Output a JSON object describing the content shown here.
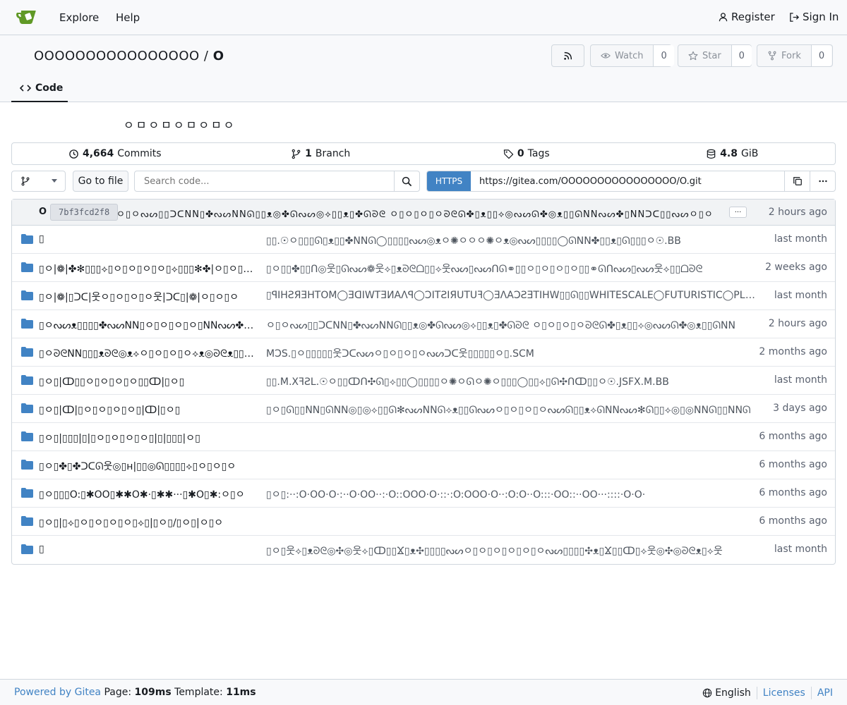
{
  "nav": {
    "explore": "Explore",
    "help": "Help",
    "register": "Register",
    "signin": "Sign In"
  },
  "repo": {
    "owner": "OOOOOOOOOOOOOOOO",
    "separator": "/",
    "name": "O",
    "description": "ㅇㅁㅇㅁㅇㅁㅇㅁㅇ",
    "watch_label": "Watch",
    "watch_count": "0",
    "star_label": "Star",
    "star_count": "0",
    "fork_label": "Fork",
    "fork_count": "0",
    "tab_code": "Code"
  },
  "stats": {
    "commits_num": "4,664",
    "commits_label": "Commits",
    "branches_num": "1",
    "branches_label": "Branch",
    "tags_num": "0",
    "tags_label": "Tags",
    "size_num": "4.8",
    "size_unit": "GiB"
  },
  "toolbar": {
    "goto_file": "Go to file",
    "search_placeholder": "Search code...",
    "clone_protocol": "HTTPS",
    "clone_url": "https://gitea.com/OOOOOOOOOOOOOOOO/O.git"
  },
  "latest_commit": {
    "author": "O",
    "sha": "7bf3fcd2f8",
    "message": "ㅇ▯ㅇᔓᔕ▯▯ᑐᑕNN▯✤ᔓᔕNNᘏ▯▯ᴥ◎✤ᘏᔓᔕ◎⟡▯▯ᴥ▯✤ᘏᘐᘓ ㅇ▯ㅇ▯ㅇ▯ㅇᘐᘓᘏ✤▯ᴥ▯▯⟡◎ᔓᔕᘏ✤◎ᴥ▯▯ᘏNNᔓᔕ✤▯NNᑐᑕ▯▯ᔓᔕㅇ▯ㅇ",
    "more": "···",
    "time": "2 hours ago"
  },
  "files": [
    {
      "name": "▯",
      "message": "▯▯.☉ㅇ▯▯▯ᘏ▯ᴥ▯▯✤NNᘏ◯▯▯▯▯ᔓᔕ◎ᴥㅇ✺ㅇㅇㅇ✺ㅇᴥ◎ᔓᔕ▯▯▯▯◯ᘏNN✤▯▯ᴥ▯ᘏ▯▯▯ㅇ☉.BB",
      "time": "last month"
    },
    {
      "name": "▯ㅇ|❁|✤✻▯▯▯⟡▯ㅇ▯ㅇ▯ㅇ▯ㅇ▯⟡▯▯▯✻✤|ㅇ▯ㅇ▯ㅇ▯ㅇ",
      "message": "▯ㅇ▯▯✤▯▯ᑎ◎웃▯ᘏᔓᔕ❁웃⟡▯ᴥᘐᘓᗝ▯▯⟡웃ᔓᔕ▯ᔓᔕᑎᘏ⚭▯▯ㅇ▯ㅇ▯ㅇ▯ㅇ▯▯⚭ᘏᑎᔓᔕ▯ᔓᔕ웃⟡▯▯ᗝᘐᘓ",
      "time": "2 weeks ago"
    },
    {
      "name": "▯ㅇ|❁|▯ᑐᑕ|웃ㅇ▯ㅇ▯ㅇ▯ㅇ웃|ᑐᑕ▯|❁|ㅇ▯ㅇ▯ㅇ",
      "message": "▯ꟼIHꙄЯƎHTOM◯ƎᗡIWTƎИAɅꟼ◯ƆITꙄIЯUTUꟻ◯ƎɅAƆꙄƎTIHW▯▯ᘏ▯▯WHITESCALE◯FUTURISTIC◯PLANETWIDE◯MOTHERSHIP",
      "time": "last month"
    },
    {
      "name": "▯ㅇᔓᔕᴥ▯▯▯▯✤ᔓᔕNN▯ㅇ▯ㅇ▯ㅇ▯ㅇ▯NNᔓᔕ✤▯▯▯▯ᴥᔓᔕㅇ▯",
      "message": "ㅇ▯ㅇᔓᔕ▯▯ᑐᑕNN▯✤ᔓᔕNNᘏ▯▯ᴥ◎✤ᘏᔓᔕ◎⟡▯▯ᴥ▯✤ᘏᘐᘓ ㅇ▯ㅇ▯ㅇ▯ㅇᘐᘓᘏ✤▯ᴥ▯▯⟡◎ᔓᔕᘏ✤◎ᴥ▯▯ᘏNN",
      "time": "2 hours ago"
    },
    {
      "name": "▯ㅇᘐᘓNN▯▯▯ᴥᘐᘓ◎ᴥ⟡ㅇ▯ㅇ▯ㅇ▯ㅇ⟡ᴥ◎ᘐᘓᴥ▯▯▯NNᘐᘓㅇ▯",
      "message": "MƆS.▯ㅇ▯▯▯▯▯웃ᑐᑕᔓᔕㅇ▯ㅇ▯ㅇ▯ㅇᔓᔕᑐᑕ웃▯▯▯▯▯ㅇ▯.SCM",
      "time": "2 months ago"
    },
    {
      "name": "▯ㅇ▯|ↀ▯▯ㅇ▯ㅇ▯ㅇ▯ㅇ▯▯ↀ|▯ㅇ▯",
      "message": "▯▯.M.XꟻƧL.☉ㅇ▯▯ↀᑎ✣ᘏ▯⟡▯▯◯▯▯▯▯ㅇ✺ㅇᘏㅇ✺ㅇ▯▯▯◯▯▯⟡▯ᘏ✣ᑎↀ▯▯ㅇ☉.JSFX.M.BB",
      "time": "last month"
    },
    {
      "name": "▯ㅇ▯|ↀ|▯ㅇ▯ㅇ▯ㅇ▯ㅇ▯|ↀ|▯ㅇ▯",
      "message": "▯ㅇ▯ᘏ▯▯NN▯ᘏNN◎▯◎⟡▯▯ᘏ✻ᔓᔕNNᘏ⟡ᴥ▯▯ᘏᔓᔕㅇ▯ㅇ▯ㅇ▯ㅇᔓᔕᘏ▯▯ᴥ⟡ᘏNNᔓᔕ✻ᘏ▯▯⟡◎▯◎NNᘏ▯▯NNᘏ",
      "time": "3 days ago"
    },
    {
      "name": "▯ㅇ▯|▯▯▯|▯|▯ㅇ▯ㅇ▯ㅇ▯ㅇ▯|▯|▯▯▯|ㅇ▯",
      "message": "",
      "time": "6 months ago"
    },
    {
      "name": "▯ㅇ▯✤▯✤ᑐᑕᘏ웃◎▯ʜ|▯▯◎ᘏ▯▯▯▯⟡▯ㅇ▯ㅇ▯ㅇ",
      "message": "",
      "time": "6 months ago"
    },
    {
      "name": "▯ㅇ▯▯▯O:▯✱OO▯✱✱O✱·▯✱✱···▯✱O▯✱:ㅇ▯ㅇ",
      "message": "▯ㅇ▯:··:O·OO·O·:··O·OO··:·O::OOO·O·::·:O:OOO·O··:O:O··O:::·OO::··OO···::::·O·O·",
      "time": "6 months ago"
    },
    {
      "name": "▯ㅇ▯|▯⟡▯ㅇ▯ㅇ▯ㅇ▯ㅇ▯⟡▯|▯ㅇ▯/▯ㅇ▯|ㅇ▯ㅇ",
      "message": "",
      "time": "6 months ago"
    },
    {
      "name": "▯",
      "message": "▯ㅇ▯웃⟡▯ᴥᘐᘓ◎✣◎웃⟡▯ↀ▯▯Ϫ▯ᴥ✣▯▯▯▯ᔓᔕㅇ▯ㅇ▯ㅇ▯ㅇ▯ㅇ▯ㅇᔓᔕ▯▯▯▯✣ᴥ▯Ϫ▯▯ↀ▯⟡웃◎✣◎ᘐᘓᴥ▯⟡웃",
      "time": "last month"
    }
  ],
  "footer": {
    "powered": "Powered by Gitea",
    "page_label": "Page:",
    "page_time": "109ms",
    "template_label": "Template:",
    "template_time": "11ms",
    "language": "English",
    "licenses": "Licenses",
    "api": "API"
  }
}
